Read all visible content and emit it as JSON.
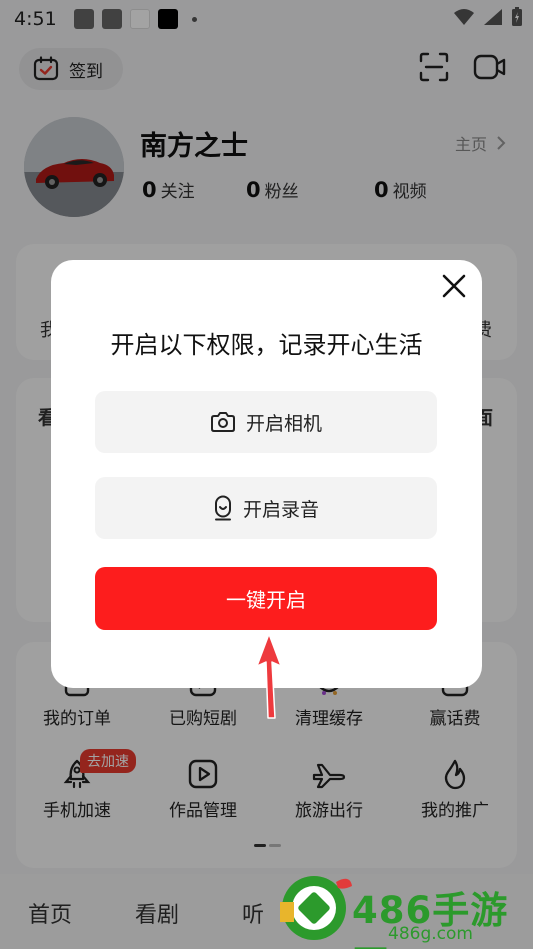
{
  "status_bar": {
    "time": "4:51"
  },
  "header": {
    "checkin_label": "签到"
  },
  "profile": {
    "name": "南方之士",
    "home_link": "主页",
    "stats": [
      {
        "count": "0",
        "label": "关注"
      },
      {
        "count": "0",
        "label": "粉丝"
      },
      {
        "count": "0",
        "label": "视频"
      }
    ]
  },
  "background_peek": {
    "left_char_1": "我",
    "right_char_1": "费",
    "left_char_2": "看",
    "right_char_2": "面"
  },
  "tools": {
    "row1": [
      {
        "label": "我的订单",
        "icon": "order-icon"
      },
      {
        "label": "已购短剧",
        "icon": "play-icon"
      },
      {
        "label": "清理缓存",
        "icon": "clean-icon"
      },
      {
        "label": "赢话费",
        "icon": "plus-icon"
      }
    ],
    "row2": [
      {
        "label": "手机加速",
        "icon": "rocket-icon"
      },
      {
        "label": "作品管理",
        "icon": "play-square-icon"
      },
      {
        "label": "旅游出行",
        "icon": "plane-icon"
      },
      {
        "label": "我的推广",
        "icon": "flame-icon"
      }
    ],
    "speed_badge": "去加速"
  },
  "bottom_nav": [
    {
      "label": "首页"
    },
    {
      "label": "看剧"
    },
    {
      "label": "听"
    }
  ],
  "modal": {
    "title": "开启以下权限，记录开心生活",
    "camera_button": "开启相机",
    "mic_button": "开启录音",
    "primary_button": "一键开启"
  },
  "watermark": {
    "title": "486手游网",
    "subtitle": "486g.com"
  },
  "colors": {
    "primary": "#fd1d1d",
    "badge": "#e83b2e",
    "watermark": "#2c9a2c"
  }
}
